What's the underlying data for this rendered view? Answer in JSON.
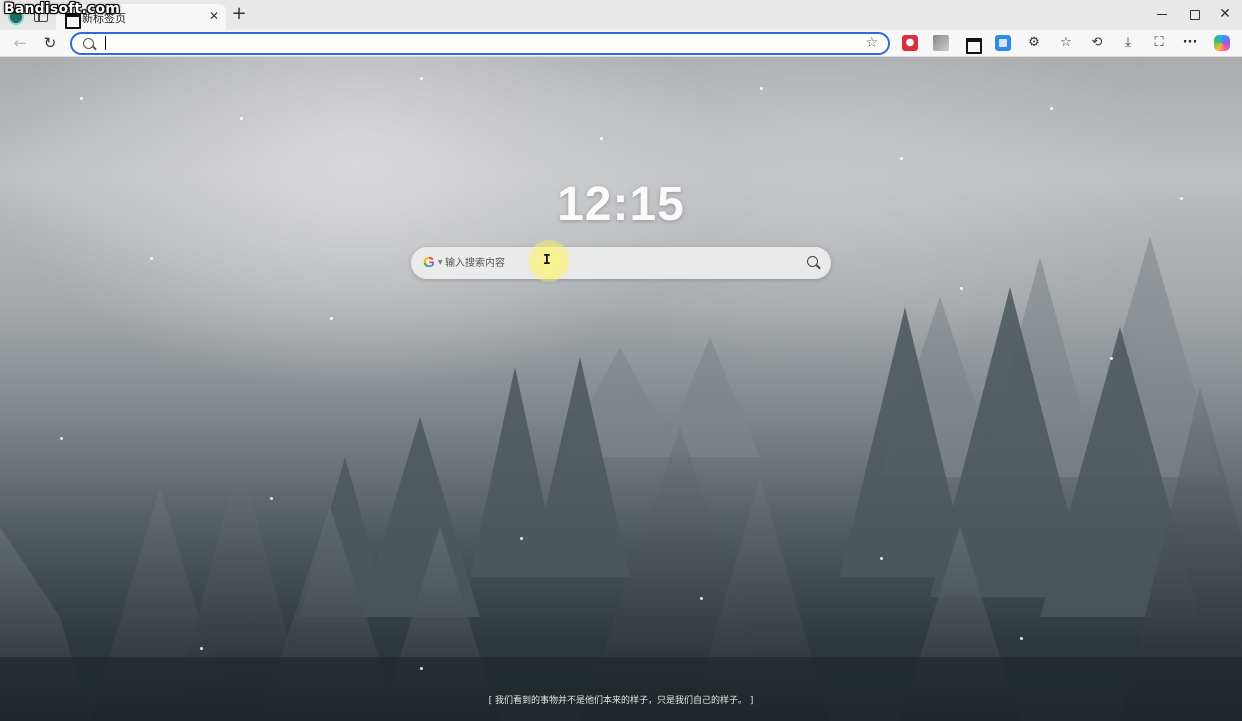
{
  "watermark": "Bandisoft.com",
  "tab": {
    "title": "新标签页",
    "close_glyph": "✕"
  },
  "newtab_glyph": "+",
  "window_controls": {
    "close_glyph": "✕"
  },
  "addressbar": {
    "value": "",
    "star_glyph": "☆"
  },
  "toolbar": {
    "back_glyph": "←",
    "refresh_glyph": "↻",
    "icons": [
      "ext-red-icon",
      "ext-image-icon",
      "ext-new-tab-icon",
      "ext-blue-icon",
      "extensions-puzzle-icon",
      "favorites-icon",
      "history-icon",
      "downloads-icon",
      "screenshot-icon",
      "more-menu-icon",
      "copilot-icon"
    ],
    "glyphs": {
      "ext1": "●",
      "puzzle": "⚙",
      "fav": "☆",
      "hist": "⟲",
      "down": "⤓",
      "shot": "⛶",
      "more": "···"
    }
  },
  "newtab_page": {
    "clock": "12:15",
    "search": {
      "engine_icon": "google-icon",
      "engine_letter": "G",
      "engine_caret": "▼",
      "placeholder": "输入搜索内容"
    },
    "quote": "[ 我们看到的事物并不是他们本来的样子，只是我们自己的样子。 ]"
  },
  "cursor_glyph": "I",
  "colors": {
    "accent": "#2f6bd6",
    "copilot": "#8a5cf6"
  }
}
